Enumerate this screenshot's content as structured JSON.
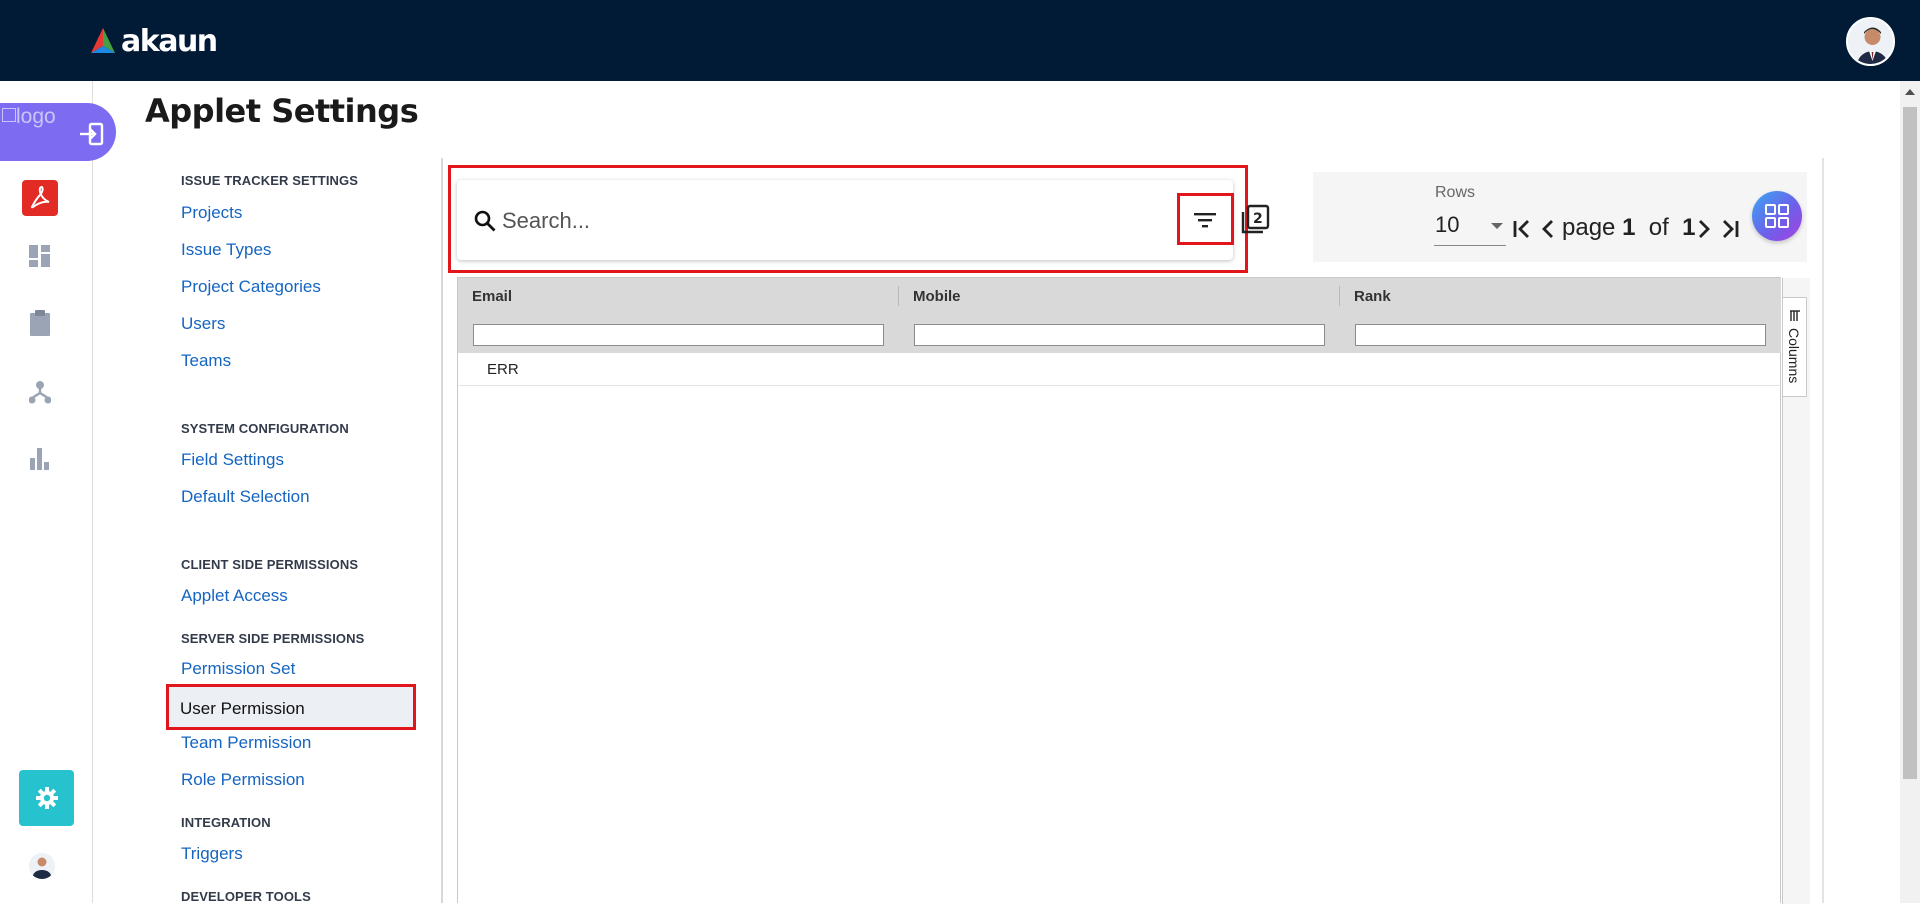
{
  "app": {
    "brand": "akaun",
    "logo_alt": "logo",
    "colors": {
      "topbar": "#011a35",
      "accent": "#7d6cf2",
      "link": "#1565c0",
      "highlight": "#e0161c",
      "settings_button": "#26c3cf"
    }
  },
  "page": {
    "title": "Applet Settings"
  },
  "rail": {
    "icons": [
      "login-icon",
      "pdf-applet-icon",
      "dashboard-icon",
      "clipboard-icon",
      "workflow-icon",
      "bar-chart-icon",
      "gear-icon",
      "avatar"
    ]
  },
  "settings_nav": {
    "sections": [
      {
        "heading": "ISSUE TRACKER SETTINGS",
        "items": [
          "Projects",
          "Issue Types",
          "Project Categories",
          "Users",
          "Teams"
        ]
      },
      {
        "heading": "SYSTEM CONFIGURATION",
        "items": [
          "Field Settings",
          "Default Selection"
        ]
      },
      {
        "heading": "CLIENT SIDE PERMISSIONS",
        "items": [
          "Applet Access"
        ]
      },
      {
        "heading": "SERVER SIDE PERMISSIONS",
        "items": [
          "Permission Set",
          "User Permission",
          "Team Permission",
          "Role Permission"
        ]
      },
      {
        "heading": "INTEGRATION",
        "items": [
          "Triggers"
        ]
      },
      {
        "heading": "DEVELOPER TOOLS",
        "items": []
      }
    ],
    "active_item": "User Permission"
  },
  "search": {
    "placeholder": "Search...",
    "value": ""
  },
  "pagination": {
    "rows_label": "Rows",
    "rows_value": "10",
    "page_word": "page",
    "current_page": "1",
    "of_word": "of",
    "total_pages": "1"
  },
  "grid": {
    "columns": [
      "Email",
      "Mobile",
      "Rank"
    ],
    "rows": [
      {
        "Email": "ERR",
        "Mobile": "",
        "Rank": ""
      }
    ],
    "side_tab": "Columns"
  }
}
